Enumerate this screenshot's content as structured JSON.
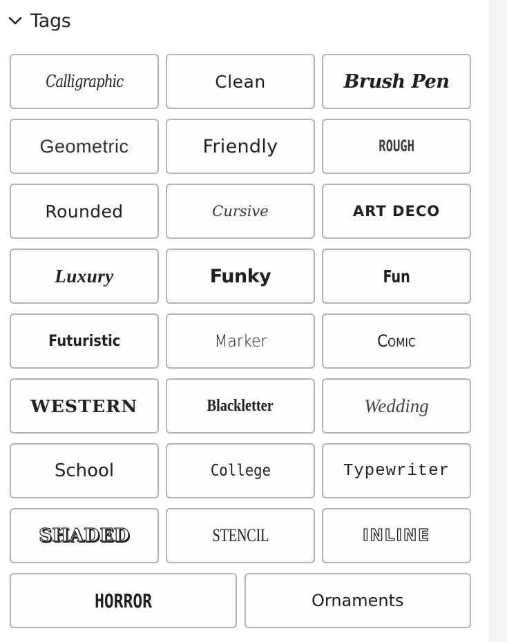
{
  "section": {
    "title": "Tags",
    "expanded": true,
    "toggle_icon": "chevron-down-icon"
  },
  "tags": [
    {
      "label": "Calligraphic",
      "style": "calligraphic"
    },
    {
      "label": "Clean",
      "style": "clean"
    },
    {
      "label": "Brush Pen",
      "style": "brush"
    },
    {
      "label": "Geometric",
      "style": "geometric"
    },
    {
      "label": "Friendly",
      "style": "friendly"
    },
    {
      "label": "ROUGH",
      "style": "rough"
    },
    {
      "label": "Rounded",
      "style": "rounded"
    },
    {
      "label": "Cursive",
      "style": "cursive"
    },
    {
      "label": "ART DECO",
      "style": "artdeco"
    },
    {
      "label": "Luxury",
      "style": "luxury"
    },
    {
      "label": "Funky",
      "style": "funky"
    },
    {
      "label": "Fun",
      "style": "fun"
    },
    {
      "label": "Futuristic",
      "style": "futuristic"
    },
    {
      "label": "Marker",
      "style": "marker"
    },
    {
      "label": "Comic",
      "style": "comic"
    },
    {
      "label": "WESTERN",
      "style": "western"
    },
    {
      "label": "Blackletter",
      "style": "blackletter"
    },
    {
      "label": "Wedding",
      "style": "wedding"
    },
    {
      "label": "School",
      "style": "school"
    },
    {
      "label": "College",
      "style": "college"
    },
    {
      "label": "Typewriter",
      "style": "typewriter"
    },
    {
      "label": "SHADED",
      "style": "shaded"
    },
    {
      "label": "STENCIL",
      "style": "stencil"
    },
    {
      "label": "INLINE",
      "style": "inline"
    },
    {
      "label": "HORROR",
      "style": "horror"
    },
    {
      "label": "Ornaments",
      "style": "ornaments"
    }
  ]
}
